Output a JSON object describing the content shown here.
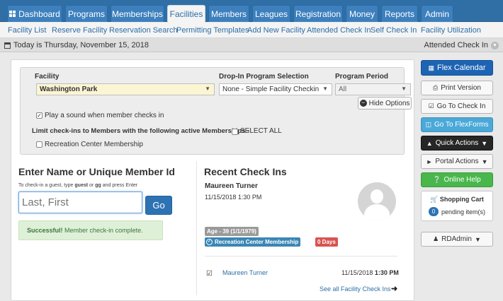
{
  "nav": {
    "tabs": [
      {
        "label": "Dashboard",
        "icon": "grid-icon"
      },
      {
        "label": "Programs"
      },
      {
        "label": "Memberships"
      },
      {
        "label": "Facilities",
        "active": true
      },
      {
        "label": "Members"
      },
      {
        "label": "Leagues"
      },
      {
        "label": "Registration"
      },
      {
        "label": "Money"
      },
      {
        "label": "Reports"
      },
      {
        "label": "Admin"
      }
    ]
  },
  "subnav": {
    "links": [
      "Facility List",
      "Reserve Facility",
      "Reservation Search",
      "Permitting Templates",
      "Add New Facility",
      "Attended Check In",
      "Self Check In",
      "Facility Utilization"
    ]
  },
  "datebar": {
    "date_text": "Today is Thursday, November 15, 2018",
    "right_label": "Attended Check In"
  },
  "options": {
    "facility_label": "Facility",
    "facility_value": "Washington Park",
    "dropin_label": "Drop-In Program Selection",
    "dropin_value": "None - Simple Facility Checkin",
    "period_label": "Program Period",
    "period_value": "All",
    "hide_options_label": "Hide Options",
    "play_sound_label": "Play a sound when member checks in",
    "play_sound_checked": true,
    "limit_label": "Limit check-ins to Members with the following active Memberships -",
    "select_all_label": "SELECT ALL",
    "membership_option_label": "Recreation Center Membership"
  },
  "entry": {
    "heading": "Enter Name or Unique Member Id",
    "hint_pre": "To check-in a guest, type",
    "hint_guest": "guest",
    "hint_or": "or",
    "hint_gg": "gg",
    "hint_post": "and press Enter",
    "placeholder": "Last, First",
    "go_label": "Go",
    "success_strong": "Successful!",
    "success_text": "Member check-in complete."
  },
  "recent": {
    "heading": "Recent Check Ins",
    "member_name": "Maureen Turner",
    "checkin_time": "11/15/2018  1:30 PM",
    "age_badge": "Age - 39 (1/1/1979)",
    "membership_badge": "Recreation Center Membership",
    "days_badge": "0 Days",
    "row_name": "Maureen Turner",
    "row_date": "11/15/2018",
    "row_time": "1:30 PM",
    "see_all": "See all Facility Check Ins"
  },
  "sidebar": {
    "flex_calendar": "Flex Calendar",
    "print_version": "Print Version",
    "go_to_checkin": "Go To Check In",
    "go_to_flexforms": "Go To FlexForms",
    "quick_actions": "Quick Actions",
    "portal_actions": "Portal Actions",
    "online_help": "Online Help",
    "cart_title": "Shopping Cart",
    "cart_count": "0",
    "cart_pending": "pending item(s)",
    "user": "RDAdmin"
  },
  "colors": {
    "nav_bg": "#2f6fa6",
    "accent_blue": "#1d64b4",
    "green": "#49b74c",
    "danger": "#d9534f"
  }
}
